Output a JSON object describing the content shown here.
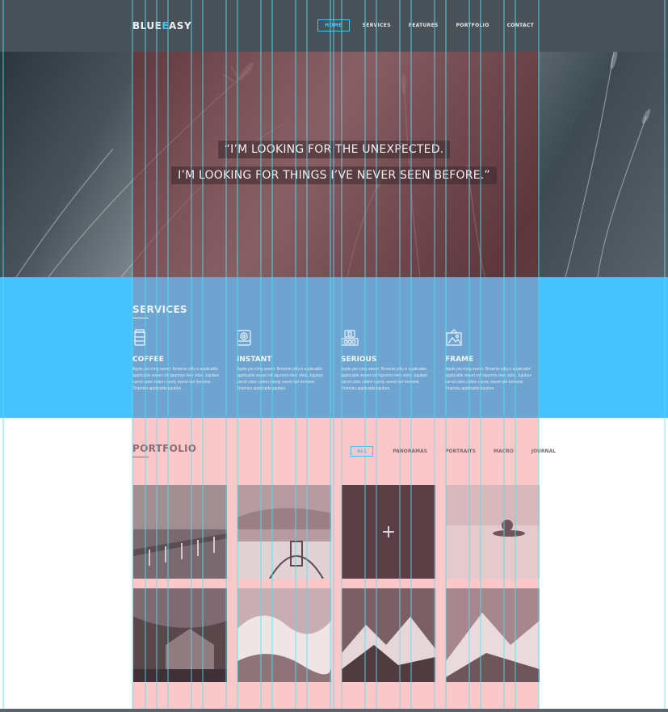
{
  "header": {
    "logo_part1": "BLUE",
    "logo_part2": "ASY",
    "logo_accent": "E",
    "nav": [
      {
        "label": "HOME",
        "active": true
      },
      {
        "label": "SERVICES",
        "active": false
      },
      {
        "label": "FEATURES",
        "active": false
      },
      {
        "label": "PORTFOLIO",
        "active": false
      },
      {
        "label": "CONTACT",
        "active": false
      }
    ]
  },
  "hero": {
    "quote_line1": "“I’M LOOKING FOR THE UNEXPECTED.",
    "quote_line2": "I’M LOOKING FOR THINGS I’VE NEVER SEEN BEFORE.”"
  },
  "services": {
    "title": "SERVICES",
    "items": [
      {
        "name": "COFFEE",
        "icon": "coffee-cup-icon",
        "desc": "Apple pie icing sweet. Brownie jelly-o applicable applicable sweet roll liquorice liver slice. Jujubes carrot cake cotton candy sweet tart brownie. Tiramisu applicable jujubes."
      },
      {
        "name": "INSTANT",
        "icon": "instant-camera-icon",
        "desc": "Apple pie icing sweet. Brownie jelly-o applicable applicable sweet roll liquorice liver slice. Jujubes carrot cake cotton candy sweet tart brownie. Tiramisu applicable jujubes."
      },
      {
        "name": "SERIOUS",
        "icon": "pro-camera-icon",
        "desc": "Apple pie icing sweet. Brownie jelly-o applicable applicable sweet roll liquorice liver slice. Jujubes carrot cake cotton candy sweet tart brownie. Tiramisu applicable jujubes."
      },
      {
        "name": "FRAME",
        "icon": "picture-frame-icon",
        "desc": "Apple pie icing sweet. Brownie jelly-o applicable applicable sweet roll liquorice liver slice. Jujubes carrot cake cotton candy sweet tart brownie. Tiramisu applicable jujubes."
      }
    ]
  },
  "portfolio": {
    "title": "PORTFOLIO",
    "filters": [
      {
        "label": "ALL",
        "active": true
      },
      {
        "label": "PANORAMAS",
        "active": false
      },
      {
        "label": "PORTRAITS",
        "active": false
      },
      {
        "label": "MACRO",
        "active": false
      },
      {
        "label": "JOURNAL",
        "active": false
      }
    ],
    "hover_symbol": "+"
  },
  "colors": {
    "accent": "#46c3ff",
    "header_bg": "#4a5259",
    "services_bg": "#46c3ff"
  }
}
